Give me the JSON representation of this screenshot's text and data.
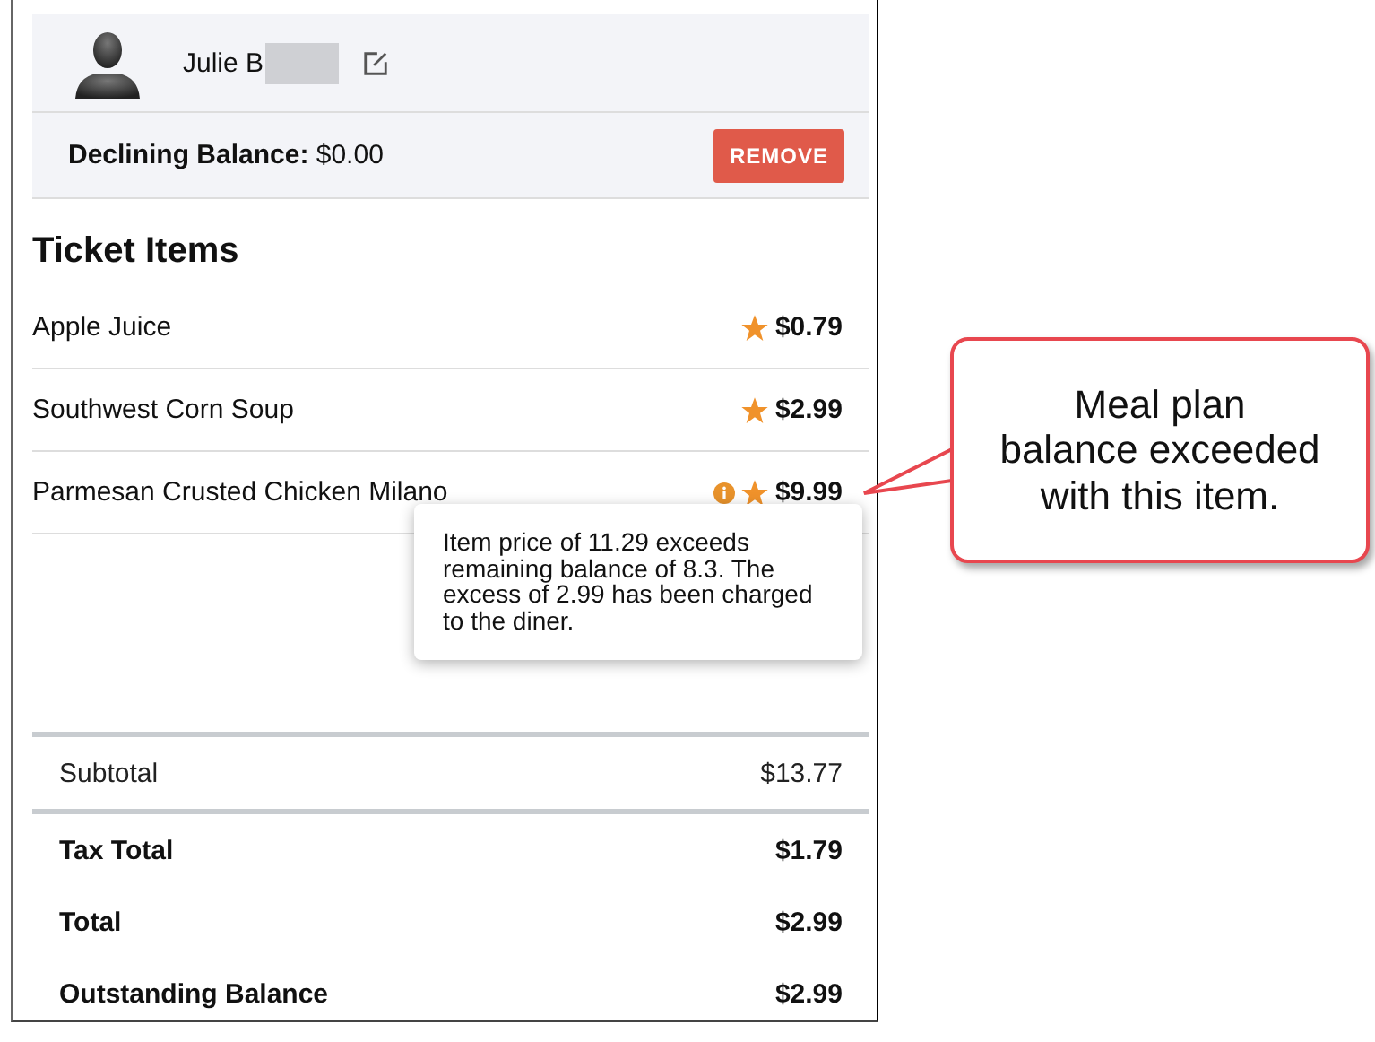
{
  "customer": {
    "name": "Julie B",
    "redacted": true,
    "balance_label": "Declining Balance:",
    "balance": "$0.00",
    "remove_button": "REMOVE"
  },
  "ticket": {
    "title": "Ticket Items",
    "items": [
      {
        "name": "Apple Juice",
        "price": "$0.79",
        "starred": true,
        "warning": false
      },
      {
        "name": "Southwest Corn Soup",
        "price": "$2.99",
        "starred": true,
        "warning": false
      },
      {
        "name": "Parmesan Crusted Chicken Milano",
        "price": "$9.99",
        "starred": true,
        "warning": true
      }
    ]
  },
  "tooltip": "Item price of 11.29 exceeds remaining balance of 8.3. The excess of 2.99 has been charged to the diner.",
  "totals": [
    {
      "label": "Subtotal",
      "value": "$13.77",
      "kind": "plain"
    },
    {
      "label": "Tax Total",
      "value": "$1.79",
      "kind": "bold"
    },
    {
      "label": "Total",
      "value": "$2.99",
      "kind": "bold"
    },
    {
      "label": "Outstanding Balance",
      "value": "$2.99",
      "kind": "bold"
    }
  ],
  "callout": {
    "lines": [
      "Meal plan",
      "balance exceeded",
      "with this item."
    ]
  }
}
